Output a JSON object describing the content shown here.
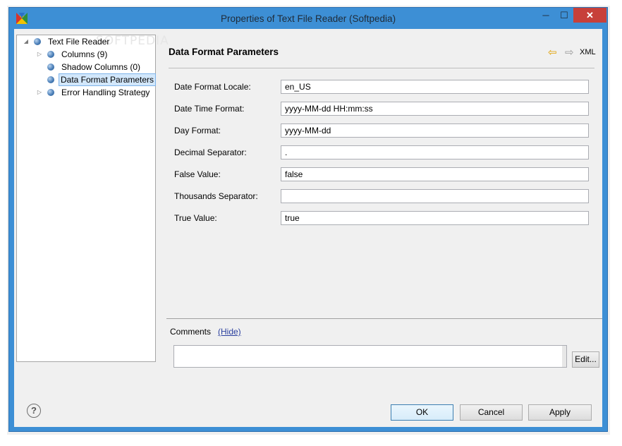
{
  "window": {
    "title": "Properties of Text File Reader (Softpedia)",
    "controls": {
      "minimize": "─",
      "maximize": "☐",
      "close": "✕"
    },
    "colors": {
      "frame": "#3d8fd5",
      "close": "#c7403a",
      "selection": "#d2e7fb"
    }
  },
  "tree": {
    "watermark": "SOFTPEDIA",
    "nodes": [
      {
        "label": "Text File Reader",
        "expander": "◢",
        "icon": "node-icon"
      },
      {
        "label": "Columns (9)",
        "expander": "▷",
        "icon": "node-icon"
      },
      {
        "label": "Shadow Columns (0)",
        "expander": "",
        "icon": "node-icon"
      },
      {
        "label": "Data Format Parameters",
        "expander": "",
        "icon": "node-icon",
        "selected": true
      },
      {
        "label": "Error Handling Strategy",
        "expander": "▷",
        "icon": "node-icon"
      }
    ]
  },
  "panel": {
    "title": "Data Format Parameters",
    "nav_back": "⇦",
    "nav_forward": "⇨",
    "xml_label": "XML",
    "fields": [
      {
        "label": "Date Format Locale:",
        "value": "en_US"
      },
      {
        "label": "Date Time Format:",
        "value": "yyyy-MM-dd HH:mm:ss"
      },
      {
        "label": "Day Format:",
        "value": "yyyy-MM-dd"
      },
      {
        "label": "Decimal Separator:",
        "value": "."
      },
      {
        "label": "False Value:",
        "value": "false"
      },
      {
        "label": "Thousands Separator:",
        "value": ""
      },
      {
        "label": "True Value:",
        "value": "true"
      }
    ]
  },
  "comments": {
    "label": "Comments",
    "hide_link": "(Hide)",
    "value": "",
    "edit_button": "Edit..."
  },
  "footer": {
    "help": "?",
    "ok": "OK",
    "cancel": "Cancel",
    "apply": "Apply"
  }
}
